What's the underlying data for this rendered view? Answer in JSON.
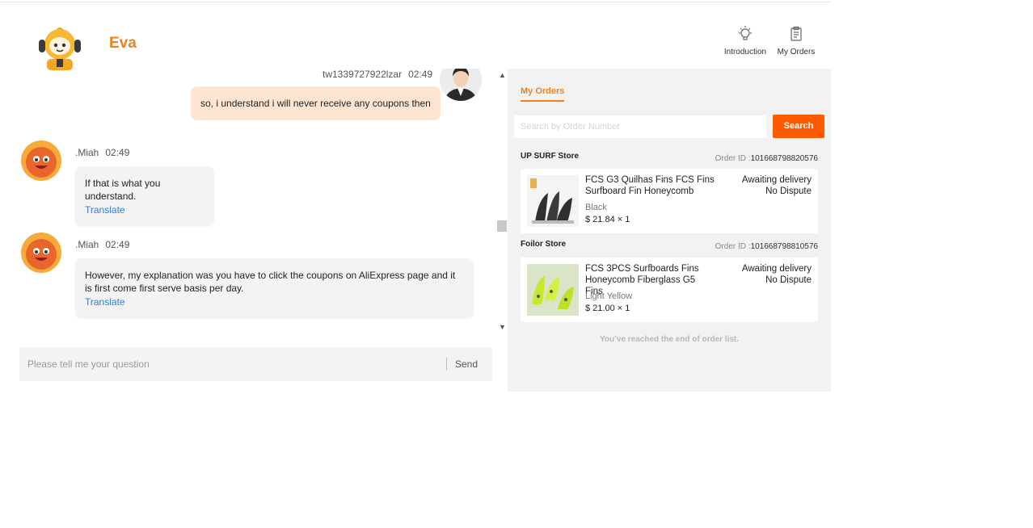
{
  "header": {
    "bot_name": "Eva",
    "nav": [
      {
        "label": "Introduction",
        "icon": "lightbulb-icon"
      },
      {
        "label": "My Orders",
        "icon": "clipboard-icon"
      }
    ]
  },
  "chat": {
    "messages": [
      {
        "sender": "tw1339727922lzar",
        "time": "02:49",
        "text": "so, i understand i will never receive any coupons then",
        "role": "user"
      },
      {
        "sender": ".Miah",
        "time": "02:49",
        "text": "If that is what you understand.",
        "translate": "Translate",
        "role": "agent"
      },
      {
        "sender": ".Miah",
        "time": "02:49",
        "text": "However, my explanation was you have to click the coupons on AliExpress page and it is first come first serve basis per day.",
        "translate": "Translate",
        "role": "agent"
      }
    ],
    "input_placeholder": "Please tell me your question",
    "send_label": "Send"
  },
  "orders": {
    "tab_label": "My Orders",
    "search_placeholder": "Search by Order Number",
    "search_button": "Search",
    "id_prefix": "Order ID :",
    "items": [
      {
        "store": "UP SURF Store",
        "order_id": "101668798820576",
        "title": "FCS G3 Quilhas Fins FCS Fins Surfboard Fin Honeycomb",
        "variant": "Black",
        "price": "$ 21.84 × 1",
        "status": "Awaiting delivery",
        "dispute": "No Dispute"
      },
      {
        "store": "Foilor Store",
        "order_id": "101668798810576",
        "title": "FCS 3PCS Surfboards Fins Honeycomb Fiberglass G5 Fins",
        "variant": "Light Yellow",
        "price": "$ 21.00 × 1",
        "status": "Awaiting delivery",
        "dispute": "No Dispute"
      }
    ],
    "end_message": "You’ve reached the end of order list."
  },
  "colors": {
    "brand_orange": "#f0801f",
    "search_button": "#ff5a00",
    "link_blue": "#2f7fd6",
    "user_bubble": "#fde5d2"
  }
}
